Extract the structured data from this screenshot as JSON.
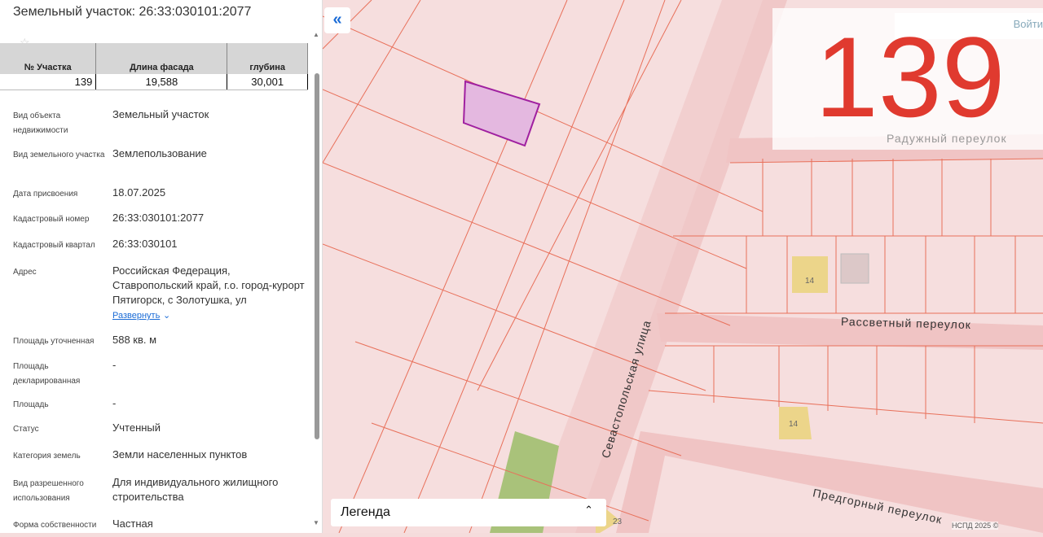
{
  "panel": {
    "title": "Земельный участок: 26:33:030101:2077",
    "table": {
      "headers": [
        "№ Участка",
        "Длина фасада",
        "глубина"
      ],
      "values": [
        "139",
        "19,588",
        "30,001"
      ]
    },
    "props": [
      {
        "k": "Вид объекта недвижимости",
        "v": "Земельный участок"
      },
      {
        "k": "Вид земельного участка",
        "v": "Землепользование"
      },
      {
        "k": "Дата присвоения",
        "v": "18.07.2025"
      },
      {
        "k": "Кадастровый номер",
        "v": "26:33:030101:2077"
      },
      {
        "k": "Кадастровый квартал",
        "v": "26:33:030101"
      },
      {
        "k": "Адрес",
        "v": "Российская Федерация, Ставропольский край, г.о. город-курорт Пятигорск, с Золотушка, ул",
        "more": "Развернуть"
      },
      {
        "k": "Площадь уточненная",
        "v": "588 кв. м"
      },
      {
        "k": "Площадь декларированная",
        "v": "-"
      },
      {
        "k": "Площадь",
        "v": "-"
      },
      {
        "k": "Статус",
        "v": "Учтенный"
      },
      {
        "k": "Категория земель",
        "v": "Земли населенных пунктов"
      },
      {
        "k": "Вид разрешенного использования",
        "v": "Для индивидуального жилищного строительства"
      },
      {
        "k": "Форма собственности",
        "v": "Частная"
      }
    ]
  },
  "map": {
    "plot_number": "139",
    "login": "Войти",
    "streets": [
      "Радужный переулок",
      "Рассветный переулок",
      "Севастопольская улица",
      "Предгорный переулок"
    ],
    "houses": [
      "14",
      "14",
      "23"
    ],
    "legend": "Легенда",
    "copyright": "НСПД 2025 ©",
    "colors": {
      "accent": "#e03a2f",
      "selected": "#a020a0",
      "link": "#1a6bd6"
    }
  }
}
